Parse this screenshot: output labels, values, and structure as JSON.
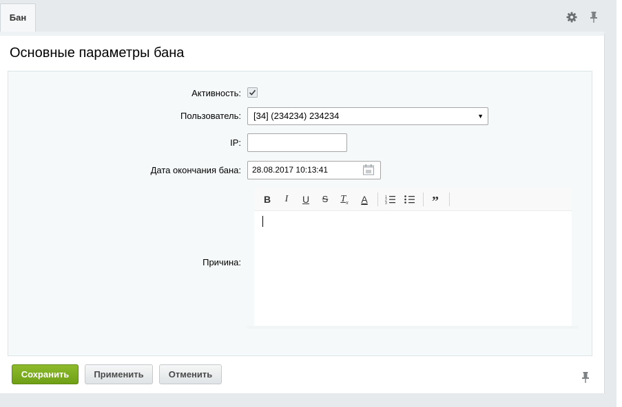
{
  "tabs": [
    {
      "label": "Бан"
    }
  ],
  "header_icons": {
    "settings": "gear-icon",
    "pin": "pin-icon"
  },
  "title": "Основные параметры бана",
  "form": {
    "active": {
      "label": "Активность:",
      "checked": true
    },
    "user": {
      "label": "Пользователь:",
      "value": "[34] (234234) 234234"
    },
    "ip": {
      "label": "IP:",
      "value": ""
    },
    "ban_end": {
      "label": "Дата окончания бана:",
      "value": "28.08.2017 10:13:41",
      "icon": "calendar-icon"
    },
    "reason": {
      "label": "Причина:",
      "value": "",
      "toolbar": [
        {
          "name": "bold",
          "glyph": "B"
        },
        {
          "name": "italic",
          "glyph": "I"
        },
        {
          "name": "underline",
          "glyph": "U"
        },
        {
          "name": "strikethrough",
          "glyph": "S"
        },
        {
          "name": "remove-format",
          "glyph": "Tx"
        },
        {
          "name": "font-color",
          "glyph": "A"
        },
        {
          "name": "ordered-list",
          "glyph": "ol"
        },
        {
          "name": "unordered-list",
          "glyph": "ul"
        },
        {
          "name": "quote",
          "glyph": "”"
        }
      ]
    }
  },
  "buttons": {
    "save": "Сохранить",
    "apply": "Применить",
    "cancel": "Отменить"
  },
  "colors": {
    "save_button": "#7aab1f",
    "panel_bg": "#f5f9f9",
    "page_bg": "#e7eaec"
  }
}
